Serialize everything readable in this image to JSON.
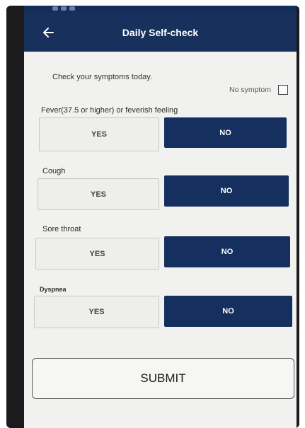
{
  "app_bar": {
    "title": "Daily Self-check",
    "back_icon": "back-arrow-icon"
  },
  "intro": "Check your symptoms today.",
  "no_symptom": {
    "label": "No symptom",
    "checked": false
  },
  "questions": [
    {
      "label": "Fever(37.5 or higher) or feverish feeling",
      "yes": "YES",
      "no": "NO",
      "selected": "NO"
    },
    {
      "label": "Cough",
      "yes": "YES",
      "no": "NO",
      "selected": "NO"
    },
    {
      "label": "Sore throat",
      "yes": "YES",
      "no": "NO",
      "selected": "NO"
    },
    {
      "label": "Dyspnea",
      "yes": "YES",
      "no": "NO",
      "selected": "NO"
    }
  ],
  "submit_label": "SUBMIT",
  "colors": {
    "app_bar": "#17315c",
    "selected_button": "#15305e",
    "unselected_button": "#eeeeeb"
  }
}
